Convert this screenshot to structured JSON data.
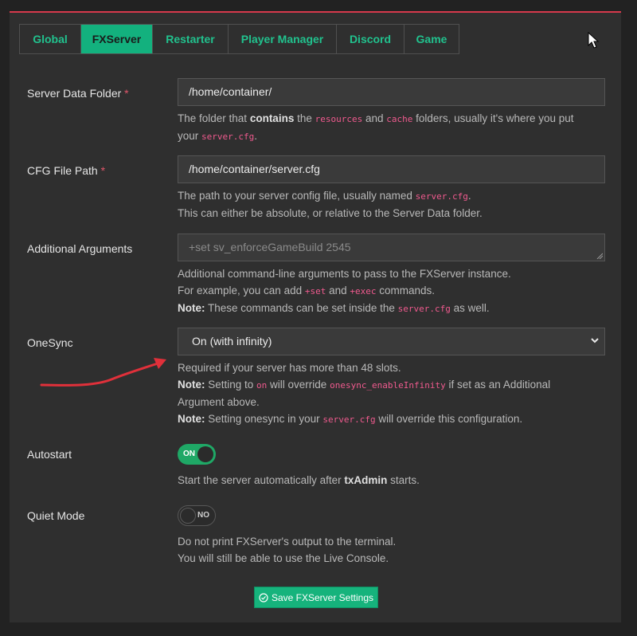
{
  "tabs": [
    {
      "label": "Global",
      "active": false
    },
    {
      "label": "FXServer",
      "active": true
    },
    {
      "label": "Restarter",
      "active": false
    },
    {
      "label": "Player Manager",
      "active": false
    },
    {
      "label": "Discord",
      "active": false
    },
    {
      "label": "Game",
      "active": false
    }
  ],
  "colors": {
    "accent": "#13b17e",
    "top_border": "#d6394c",
    "code": "#ef5a8e"
  },
  "fields": {
    "server_data_folder": {
      "label": "Server Data Folder",
      "required_mark": "*",
      "value": "/home/container/",
      "help": {
        "p1": "The folder that ",
        "b1": "contains",
        "p2": " the ",
        "c1": "resources",
        "p3": " and ",
        "c2": "cache",
        "p4": " folders, usually it's where you put",
        "p5": "your ",
        "c3": "server.cfg",
        "p6": "."
      }
    },
    "cfg_file_path": {
      "label": "CFG File Path",
      "required_mark": "*",
      "value": "/home/container/server.cfg",
      "help": {
        "p1": "The path to your server config file, usually named ",
        "c1": "server.cfg",
        "p2": ".",
        "line2": "This can either be absolute, or relative to the Server Data folder."
      }
    },
    "additional_arguments": {
      "label": "Additional Arguments",
      "placeholder": "+set sv_enforceGameBuild 2545",
      "help": {
        "line1": "Additional command-line arguments to pass to the FXServer instance.",
        "p1": "For example, you can add ",
        "c1": "+set",
        "p2": " and ",
        "c2": "+exec",
        "p3": " commands.",
        "note": "Note:",
        "p4": " These commands can be set inside the ",
        "c3": "server.cfg",
        "p5": " as well."
      }
    },
    "onesync": {
      "label": "OneSync",
      "selected": "On (with infinity)",
      "help": {
        "line1": "Required if your server has more than 48 slots.",
        "note1": "Note:",
        "p1": " Setting to ",
        "c1": "on",
        "p2": " will override ",
        "c2": "onesync_enableInfinity",
        "p3": " if set as an Additional",
        "p4": "Argument above.",
        "note2": "Note:",
        "p5": " Setting onesync in your ",
        "c3": "server.cfg",
        "p6": " will override this configuration."
      }
    },
    "autostart": {
      "label": "Autostart",
      "state": "ON",
      "help": {
        "p1": "Start the server automatically after ",
        "b1": "txAdmin",
        "p2": " starts."
      }
    },
    "quiet_mode": {
      "label": "Quiet Mode",
      "state": "NO",
      "help": {
        "line1": "Do not print FXServer's output to the terminal.",
        "line2": "You will still be able to use the Live Console."
      }
    }
  },
  "save_button": {
    "label": "Save FXServer Settings",
    "icon": "check-circle-icon"
  }
}
